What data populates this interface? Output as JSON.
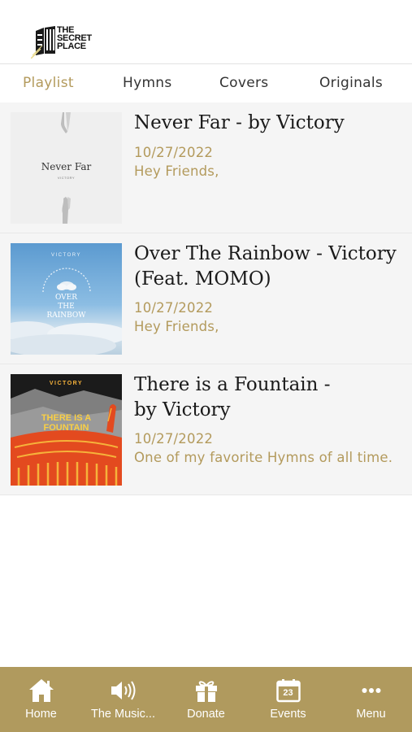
{
  "app": {
    "logo_text": "THE SECRET PLACE"
  },
  "tabs": [
    {
      "label": "Playlist",
      "active": true
    },
    {
      "label": "Hymns",
      "active": false
    },
    {
      "label": "Covers",
      "active": false
    },
    {
      "label": "Originals",
      "active": false
    }
  ],
  "posts": [
    {
      "title": "Never Far - by Victory",
      "date": "10/27/2022",
      "excerpt": "Hey Friends,",
      "art_text": "Never Far",
      "art_subtext": "VICTORY"
    },
    {
      "title": "Over The Rainbow - Victory (Feat. MOMO)",
      "date": "10/27/2022",
      "excerpt": "Hey Friends,",
      "art_text_1": "OVER",
      "art_text_2": "THE",
      "art_text_3": "RAINBOW",
      "art_subtext": "VICTORY"
    },
    {
      "title": "There is a Fountain - by Victory",
      "date": "10/27/2022",
      "excerpt": "One of my favorite Hymns of all time.",
      "art_top": "VICTORY",
      "art_text_1": "THERE IS A",
      "art_text_2": "FOUNTAIN"
    }
  ],
  "bottom_nav": [
    {
      "label": "Home",
      "icon": "home-icon"
    },
    {
      "label": "The Music...",
      "icon": "speaker-icon"
    },
    {
      "label": "Donate",
      "icon": "gift-icon"
    },
    {
      "label": "Events",
      "icon": "calendar-icon",
      "icon_text": "23"
    },
    {
      "label": "Menu",
      "icon": "more-icon"
    }
  ],
  "colors": {
    "accent": "#b39a5c",
    "nav_bg": "#b09a5e",
    "item_bg": "#f5f5f5"
  }
}
